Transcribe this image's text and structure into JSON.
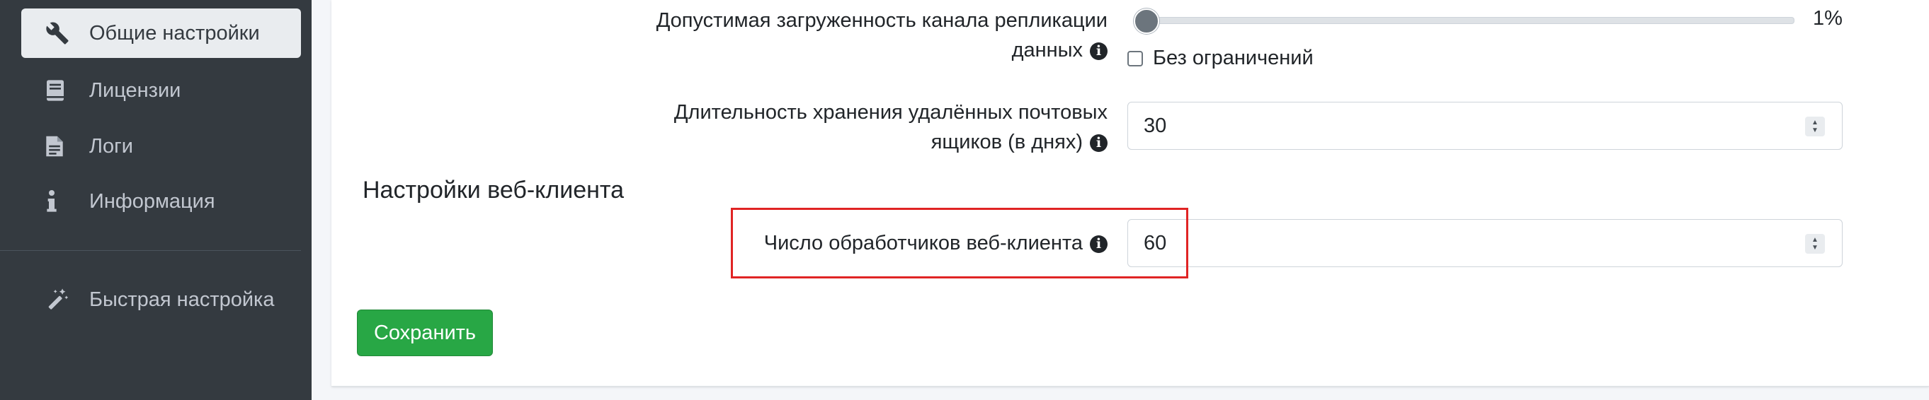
{
  "sidebar": {
    "items": [
      {
        "label": "Общие настройки",
        "icon": "wrench-icon",
        "active": true
      },
      {
        "label": "Лицензии",
        "icon": "book-icon",
        "active": false
      },
      {
        "label": "Логи",
        "icon": "file-icon",
        "active": false
      },
      {
        "label": "Информация",
        "icon": "info-icon",
        "active": false
      },
      {
        "label": "Быстрая настройка",
        "icon": "magic-wand-icon",
        "active": false
      }
    ]
  },
  "settings": {
    "replication": {
      "label_line1": "Допустимая загруженность канала репликации",
      "label_line2": "данных",
      "value_text": "1%",
      "value_fraction": 0.01,
      "unlimited_label": "Без ограничений",
      "unlimited_checked": false
    },
    "deleted_mailboxes": {
      "label_line1": "Длительность хранения удалённых почтовых",
      "label_line2": "ящиков (в днях)",
      "value": "30"
    }
  },
  "web_client": {
    "section_title": "Настройки веб-клиента",
    "handlers_label": "Число обработчиков веб-клиента",
    "handlers_value": "60"
  },
  "actions": {
    "save_label": "Сохранить"
  },
  "colors": {
    "sidebar_bg": "#343a40",
    "save_button": "#28a745",
    "highlight": "#e02424",
    "slider_fill": "#007bff"
  }
}
